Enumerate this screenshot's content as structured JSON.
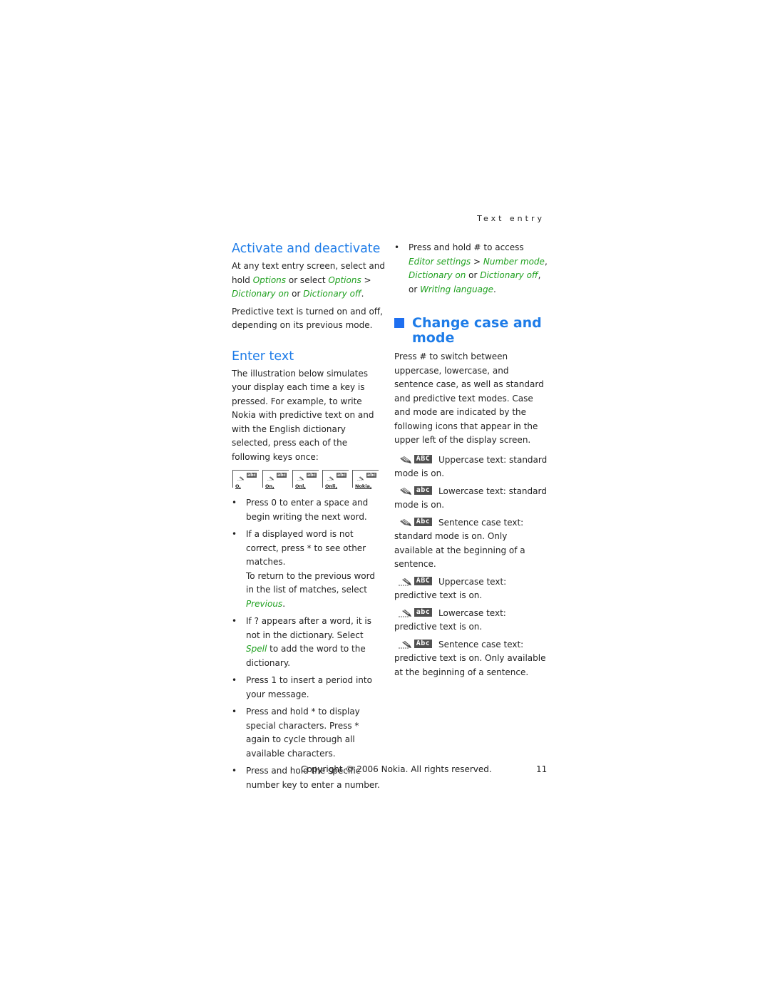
{
  "running_head": "Text entry",
  "left": {
    "activate": {
      "heading": "Activate and deactivate",
      "para1": [
        {
          "t": "At any text entry screen, select and hold ",
          "g": false
        },
        {
          "t": "Options",
          "g": true
        },
        {
          "t": " or select ",
          "g": false
        },
        {
          "t": "Options",
          "g": true
        },
        {
          "t": " > ",
          "g": false
        },
        {
          "t": "Dictionary on",
          "g": true
        },
        {
          "t": " or ",
          "g": false
        },
        {
          "t": "Dictionary off",
          "g": true
        },
        {
          "t": ".",
          "g": false
        }
      ],
      "para2": "Predictive text is turned on and off, depending on its previous mode."
    },
    "enter": {
      "heading": "Enter text",
      "para": "The illustration below simulates your display each time a key is pressed. For example, to write Nokia with predictive text on and with the English dictionary selected, press each of the following keys once:",
      "screens": [
        {
          "mode": "abc",
          "word": "O,"
        },
        {
          "mode": "abc",
          "word": "On,"
        },
        {
          "mode": "abc",
          "word": "Onl,"
        },
        {
          "mode": "abc",
          "word": "Onli,"
        },
        {
          "mode": "abc",
          "word": "Nokia,"
        }
      ],
      "bullets": [
        [
          {
            "t": "Press 0 to enter a space and begin writing the next word.",
            "g": false
          }
        ],
        [
          {
            "t": "If a displayed word is not correct, press * to see other matches.",
            "g": false
          },
          {
            "br": true
          },
          {
            "t": "To return to the previous word in the list of matches, select ",
            "g": false
          },
          {
            "t": "Previous",
            "g": true
          },
          {
            "t": ".",
            "g": false
          }
        ],
        [
          {
            "t": "If ? appears after a word, it is not in the dictionary. Select ",
            "g": false
          },
          {
            "t": "Spell",
            "g": true
          },
          {
            "t": " to add the word to the dictionary.",
            "g": false
          }
        ],
        [
          {
            "t": "Press 1 to insert a period into your message.",
            "g": false
          }
        ],
        [
          {
            "t": "Press and hold * to display special characters. Press * again to cycle through all available characters.",
            "g": false
          }
        ],
        [
          {
            "t": "Press and hold the specific number key to enter a number.",
            "g": false
          }
        ]
      ]
    }
  },
  "right": {
    "top_bullet": [
      {
        "t": "Press and hold # to access ",
        "g": false
      },
      {
        "t": "Editor settings",
        "g": true
      },
      {
        "t": " > ",
        "g": false
      },
      {
        "t": "Number mode",
        "g": true
      },
      {
        "t": ", ",
        "g": false
      },
      {
        "t": "Dictionary on",
        "g": true
      },
      {
        "t": " or ",
        "g": false
      },
      {
        "t": "Dictionary off",
        "g": true
      },
      {
        "t": ", or ",
        "g": false
      },
      {
        "t": "Writing language",
        "g": true
      },
      {
        "t": ".",
        "g": false
      }
    ],
    "change": {
      "heading": "Change case and mode",
      "para": "Press # to switch between uppercase, lowercase, and sentence case, as well as standard and predictive text modes. Case and mode are indicated by the following icons that appear in the upper left of the display screen.",
      "indicators": [
        {
          "mode": "standard",
          "badge": "ABC",
          "text": "Uppercase text: standard mode is on."
        },
        {
          "mode": "standard",
          "badge": "abc",
          "text": "Lowercase text: standard mode is on."
        },
        {
          "mode": "standard",
          "badge": "Abc",
          "text": "Sentence case text: standard mode is on. Only available at the beginning of a sentence."
        },
        {
          "mode": "predictive",
          "badge": "ABC",
          "text": "Uppercase text: predictive text is on."
        },
        {
          "mode": "predictive",
          "badge": "abc",
          "text": "Lowercase text: predictive text is on."
        },
        {
          "mode": "predictive",
          "badge": "Abc",
          "text": "Sentence case text: predictive text is on. Only available at the beginning of a sentence."
        }
      ]
    }
  },
  "footer": {
    "copyright": "Copyright © 2006 Nokia. All rights reserved.",
    "page_number": "11"
  },
  "colors": {
    "heading": "#1e7ce8",
    "menu_term": "#1fa01f"
  }
}
